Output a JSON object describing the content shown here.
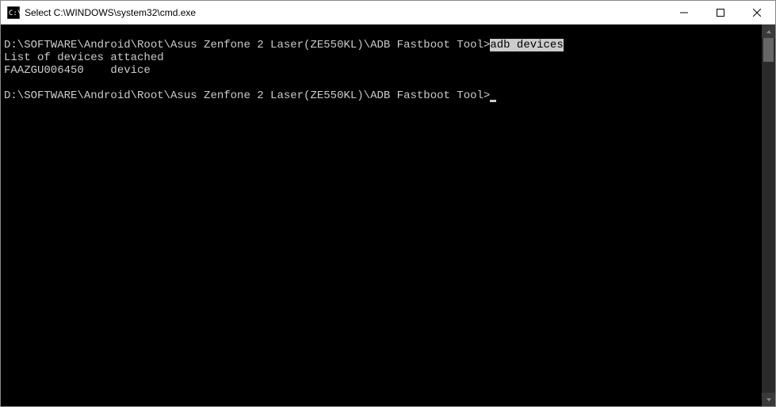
{
  "titlebar": {
    "title": "Select C:\\WINDOWS\\system32\\cmd.exe"
  },
  "terminal": {
    "line1_prompt": "D:\\SOFTWARE\\Android\\Root\\Asus Zenfone 2 Laser(ZE550KL)\\ADB Fastboot Tool>",
    "line1_command": "adb devices",
    "line2": "List of devices attached",
    "line3": "FAAZGU006450    device",
    "line4_prompt": "D:\\SOFTWARE\\Android\\Root\\Asus Zenfone 2 Laser(ZE550KL)\\ADB Fastboot Tool>"
  }
}
